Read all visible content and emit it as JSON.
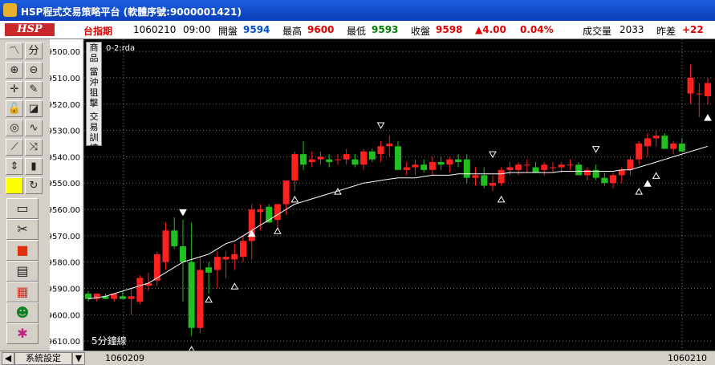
{
  "window": {
    "title": "HSP程式交易策略平台 (軟體序號:9000001421)",
    "icon": "hsp-app-icon"
  },
  "quote": {
    "logo": "HSP",
    "symbol": "台指期",
    "date": "1060210",
    "time": "09:00",
    "open_label": "開盤",
    "open": "9594",
    "high_label": "最高",
    "high": "9600",
    "low_label": "最低",
    "low": "9593",
    "close_label": "收盤",
    "close": "9598",
    "change": "▲4.00",
    "change_pct": "0.04%",
    "volume_label": "成交量",
    "volume": "2033",
    "diff_label": "昨差",
    "diff": "+22"
  },
  "toolbar": {
    "buttons": [
      {
        "name": "trend-line-icon",
        "glyph": "〽"
      },
      {
        "name": "split-icon",
        "glyph": "分"
      },
      {
        "name": "zoom-in-icon",
        "glyph": "⊕"
      },
      {
        "name": "zoom-out-icon",
        "glyph": "⊖"
      },
      {
        "name": "crosshair-icon",
        "glyph": "✛"
      },
      {
        "name": "pen-icon",
        "glyph": "✎"
      },
      {
        "name": "unlock-icon",
        "glyph": "🔓"
      },
      {
        "name": "eraser-icon",
        "glyph": "◪"
      },
      {
        "name": "indicator-icon",
        "glyph": "◎"
      },
      {
        "name": "wave-icon",
        "glyph": "∿"
      },
      {
        "name": "fibonacci-icon",
        "glyph": "⟋"
      },
      {
        "name": "cross-icon",
        "glyph": "⤨"
      },
      {
        "name": "up-down-icon",
        "glyph": "⇕"
      },
      {
        "name": "candle-icon",
        "glyph": "▮"
      },
      {
        "name": "color-icon",
        "glyph": ""
      },
      {
        "name": "refresh-icon",
        "glyph": "↻"
      }
    ],
    "big_buttons": [
      {
        "name": "folder-icon",
        "glyph": "▭"
      },
      {
        "name": "scissors-icon",
        "glyph": "✂"
      },
      {
        "name": "stop-icon",
        "glyph": "■"
      },
      {
        "name": "report-icon",
        "glyph": "▤"
      },
      {
        "name": "grid-icon",
        "glyph": "▦"
      },
      {
        "name": "people-icon",
        "glyph": "☻"
      },
      {
        "name": "strategy-icon",
        "glyph": "✱"
      }
    ]
  },
  "sidemenu": {
    "group1": [
      "商",
      "品"
    ],
    "group2": [
      "當",
      "沖",
      "狙",
      "擊"
    ],
    "group3": [
      "交",
      "易",
      "訓",
      "練"
    ]
  },
  "chart": {
    "series_tag": "0-2:rda",
    "period_label": "5分鐘線",
    "y_ticks": [
      "9610.00",
      "9600.00",
      "9590.00",
      "9580.00",
      "9570.00",
      "9560.00",
      "9550.00",
      "9540.00",
      "9530.00",
      "9520.00",
      "9510.00",
      "9500.00"
    ]
  },
  "statusbar": {
    "settings_label": "系統設定",
    "date_left": "1060209",
    "date_right": "1060210"
  },
  "colors": {
    "up": "#ff2020",
    "down": "#20c020",
    "background": "#000000",
    "ma_line": "#ffffff"
  },
  "chart_data": {
    "type": "candlestick",
    "ylim": [
      9497,
      9614
    ],
    "y_ticks": [
      9500,
      9510,
      9520,
      9530,
      9540,
      9550,
      9560,
      9570,
      9580,
      9590,
      9600,
      9610
    ],
    "candles": [
      [
        9518,
        9519,
        9515,
        9516
      ],
      [
        9516,
        9518,
        9515,
        9518
      ],
      [
        9517,
        9518,
        9516,
        9516
      ],
      [
        9516,
        9518,
        9515,
        9518
      ],
      [
        9517,
        9519,
        9516,
        9516
      ],
      [
        9516,
        9520,
        9510,
        9517
      ],
      [
        9515,
        9525,
        9514,
        9524
      ],
      [
        9521,
        9526,
        9519,
        9522
      ],
      [
        9523,
        9534,
        9521,
        9533
      ],
      [
        9530,
        9545,
        9527,
        9542
      ],
      [
        9542,
        9547,
        9535,
        9536
      ],
      [
        9536,
        9546,
        9515,
        9530
      ],
      [
        9530,
        9545,
        9502,
        9505
      ],
      [
        9505,
        9532,
        9503,
        9527
      ],
      [
        9528,
        9530,
        9518,
        9526
      ],
      [
        9527,
        9534,
        9520,
        9532
      ],
      [
        9531,
        9534,
        9524,
        9532
      ],
      [
        9531,
        9537,
        9527,
        9533
      ],
      [
        9532,
        9540,
        9530,
        9538
      ],
      [
        9538,
        9552,
        9531,
        9550
      ],
      [
        9549,
        9552,
        9542,
        9550
      ],
      [
        9551,
        9552,
        9545,
        9545
      ],
      [
        9546,
        9552,
        9543,
        9552
      ],
      [
        9552,
        9561,
        9548,
        9561
      ],
      [
        9561,
        9572,
        9557,
        9571
      ],
      [
        9571,
        9576,
        9565,
        9567
      ],
      [
        9568,
        9572,
        9566,
        9569
      ],
      [
        9569,
        9572,
        9567,
        9570
      ],
      [
        9569,
        9571,
        9566,
        9568
      ],
      [
        9569,
        9571,
        9567,
        9569
      ],
      [
        9569,
        9573,
        9567,
        9571
      ],
      [
        9569,
        9571,
        9566,
        9567
      ],
      [
        9567,
        9573,
        9565,
        9572
      ],
      [
        9572,
        9573,
        9568,
        9569
      ],
      [
        9571,
        9576,
        9568,
        9574
      ],
      [
        9574,
        9578,
        9570,
        9575
      ],
      [
        9574,
        9576,
        9570,
        9565
      ],
      [
        9565,
        9568,
        9563,
        9566
      ],
      [
        9566,
        9569,
        9563,
        9567
      ],
      [
        9567,
        9569,
        9564,
        9565
      ],
      [
        9565,
        9570,
        9563,
        9568
      ],
      [
        9568,
        9570,
        9565,
        9567
      ],
      [
        9567,
        9570,
        9564,
        9569
      ],
      [
        9569,
        9571,
        9566,
        9568
      ],
      [
        9569,
        9571,
        9560,
        9562
      ],
      [
        9562,
        9566,
        9559,
        9563
      ],
      [
        9563,
        9566,
        9558,
        9559
      ],
      [
        9559,
        9563,
        9557,
        9560
      ],
      [
        9560,
        9566,
        9559,
        9565
      ],
      [
        9565,
        9568,
        9563,
        9566
      ],
      [
        9565,
        9568,
        9563,
        9567
      ],
      [
        9567,
        9569,
        9564,
        9567
      ],
      [
        9566,
        9568,
        9564,
        9564
      ],
      [
        9565,
        9568,
        9563,
        9567
      ],
      [
        9566,
        9568,
        9564,
        9566
      ],
      [
        9566,
        9568,
        9564,
        9567
      ],
      [
        9567,
        9569,
        9565,
        9567
      ],
      [
        9567,
        9568,
        9563,
        9563
      ],
      [
        9563,
        9566,
        9561,
        9565
      ],
      [
        9565,
        9567,
        9561,
        9562
      ],
      [
        9562,
        9564,
        9559,
        9560
      ],
      [
        9560,
        9564,
        9558,
        9563
      ],
      [
        9563,
        9566,
        9560,
        9565
      ],
      [
        9565,
        9570,
        9563,
        9569
      ],
      [
        9569,
        9576,
        9567,
        9575
      ],
      [
        9574,
        9579,
        9570,
        9577
      ],
      [
        9577,
        9580,
        9574,
        9578
      ],
      [
        9578,
        9579,
        9573,
        9573
      ],
      [
        9573,
        9576,
        9571,
        9575
      ],
      [
        9575,
        9577,
        9572,
        9572
      ],
      [
        9594,
        9605,
        9590,
        9600
      ],
      [
        9594,
        9598,
        9585,
        9594
      ],
      [
        9593,
        9600,
        9590,
        9598
      ]
    ],
    "ma": [
      9516,
      9516.5,
      9517,
      9518,
      9519,
      9520,
      9521,
      9522,
      9524,
      9526,
      9528,
      9530,
      9531,
      9532,
      9533,
      9535,
      9537,
      9538,
      9540,
      9542,
      9544,
      9546,
      9548,
      9550,
      9552,
      9553,
      9554,
      9555,
      9556,
      9557,
      9558,
      9559,
      9560,
      9560.5,
      9561,
      9561.5,
      9562,
      9562,
      9562,
      9562.5,
      9563,
      9563,
      9563,
      9563.5,
      9563.5,
      9563.5,
      9563.5,
      9563.5,
      9563.5,
      9564,
      9564,
      9564,
      9564,
      9564,
      9564,
      9564.5,
      9564.5,
      9564.5,
      9564.5,
      9564.5,
      9564.5,
      9564.5,
      9565,
      9565,
      9566,
      9567,
      9568,
      9569,
      9570,
      9571,
      9572,
      9573,
      9574
    ],
    "markers": [
      {
        "i": 11,
        "dir": "down",
        "price": 9549
      },
      {
        "i": 12,
        "dir": "up",
        "price": 9497
      },
      {
        "i": 14,
        "dir": "up",
        "price": 9516
      },
      {
        "i": 17,
        "dir": "up",
        "price": 9521
      },
      {
        "i": 19,
        "dir": "up",
        "price": 9541
      },
      {
        "i": 22,
        "dir": "up",
        "price": 9542
      },
      {
        "i": 24,
        "dir": "up",
        "price": 9554
      },
      {
        "i": 29,
        "dir": "up",
        "price": 9557
      },
      {
        "i": 34,
        "dir": "down",
        "price": 9582
      },
      {
        "i": 47,
        "dir": "down",
        "price": 9571
      },
      {
        "i": 48,
        "dir": "up",
        "price": 9554
      },
      {
        "i": 59,
        "dir": "down",
        "price": 9573
      },
      {
        "i": 64,
        "dir": "up",
        "price": 9557
      },
      {
        "i": 65,
        "dir": "up",
        "price": 9560
      },
      {
        "i": 66,
        "dir": "up",
        "price": 9563
      },
      {
        "i": 72,
        "dir": "up",
        "price": 9585
      }
    ]
  }
}
